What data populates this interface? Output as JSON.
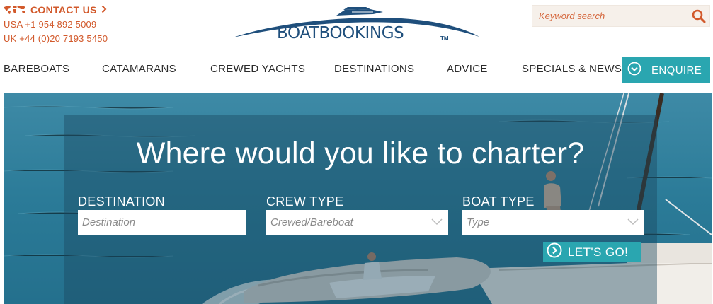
{
  "contact": {
    "label": "CONTACT US",
    "usa_phone": "USA +1 954 892 5009",
    "uk_phone": "UK +44 (0)20 7193 5450"
  },
  "logo": {
    "text": "BOATBOOKINGS",
    "tm": "TM"
  },
  "search": {
    "placeholder": "Keyword search"
  },
  "nav": {
    "items": [
      "BAREBOATS",
      "CATAMARANS",
      "CREWED YACHTS",
      "DESTINATIONS",
      "ADVICE",
      "SPECIALS & NEWS"
    ],
    "enquire": "ENQUIRE"
  },
  "hero": {
    "headline": "Where would you like to charter?",
    "destination_label": "DESTINATION",
    "destination_placeholder": "Destination",
    "crew_label": "CREW TYPE",
    "crew_value": "Crewed/Bareboat",
    "boat_label": "BOAT TYPE",
    "boat_value": "Type",
    "go_label": "LET'S GO!"
  },
  "colors": {
    "accent_orange": "#d2592b",
    "accent_teal": "#2aa6b0",
    "logo_blue": "#1f4f7c"
  },
  "icons": [
    "world-map-icon",
    "chevron-right-icon",
    "search-icon",
    "check-circle-icon",
    "chevron-down-icon",
    "arrow-circle-right-icon"
  ]
}
